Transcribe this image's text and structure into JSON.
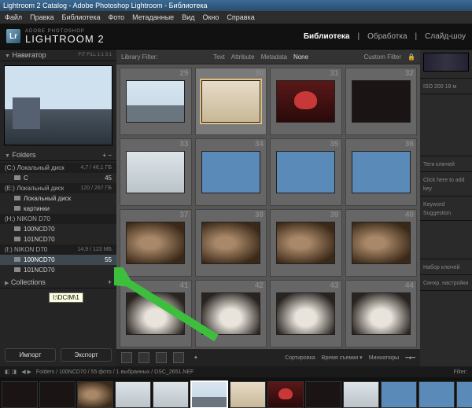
{
  "title": "Lightroom 2 Catalog - Adobe Photoshop Lightroom - Библиотека",
  "menu": [
    "Файл",
    "Правка",
    "Библиотека",
    "Фото",
    "Метаданные",
    "Вид",
    "Окно",
    "Справка"
  ],
  "brand": {
    "sub": "ADOBE PHOTOSHOP",
    "main": "LIGHTROOM 2"
  },
  "modules": {
    "items": [
      "Библиотека",
      "Обработка",
      "Слайд-шоу"
    ],
    "active": 0
  },
  "left": {
    "navigator": {
      "title": "Навигатор",
      "opts": "FIT  FILL  1:1  3:1"
    },
    "folders": {
      "title": "Folders"
    },
    "volumes": [
      {
        "name": "(C:) Локальный диск",
        "meter": "4,7 / 46,1 ГБ",
        "children": [
          {
            "name": "C",
            "count": "45"
          }
        ]
      },
      {
        "name": "(E:) Локальный диск",
        "meter": "120 / 267 ГБ",
        "children": [
          {
            "name": "Локальный диск",
            "count": ""
          },
          {
            "name": "картинки",
            "count": ""
          }
        ]
      },
      {
        "name": "(H:) NIKON D70",
        "meter": "",
        "children": [
          {
            "name": "100NCD70",
            "count": ""
          },
          {
            "name": "101NCD70",
            "count": ""
          }
        ]
      },
      {
        "name": "(I:) NIKON D70",
        "meter": "14,9 / 123 МБ",
        "children": [
          {
            "name": "100NCD70",
            "count": "55",
            "sel": true
          },
          {
            "name": "101NCD70",
            "count": ""
          }
        ]
      }
    ],
    "collections": {
      "title": "Collections"
    },
    "tooltip": "I:\\DCIM\\1",
    "import": "Импорт",
    "export": "Экспорт"
  },
  "filter": {
    "label": "Library Filter:",
    "tabs": [
      "Text",
      "Attribute",
      "Metadata",
      "None"
    ],
    "custom": "Custom Filter"
  },
  "grid": {
    "start": 29,
    "count": 16,
    "selected": 1
  },
  "toolbar": {
    "sort": "Сортировка",
    "sortval": "Время съемки",
    "thumbs": "Миниатюры"
  },
  "right": {
    "iso": "ISO 200   18 м",
    "labels": [
      "",
      "",
      "",
      "",
      ""
    ],
    "tags": "Теги ключей",
    "addhint": "Click here to add key",
    "suggest": "Keyword Suggestion",
    "sets": "Набор ключей",
    "sync": "Синхр. настройки"
  },
  "status": {
    "path": "Folders / 100NCD70 / 55 фото / 1 выбранных / DSC_2651.NEF",
    "filter": "Filter:"
  }
}
